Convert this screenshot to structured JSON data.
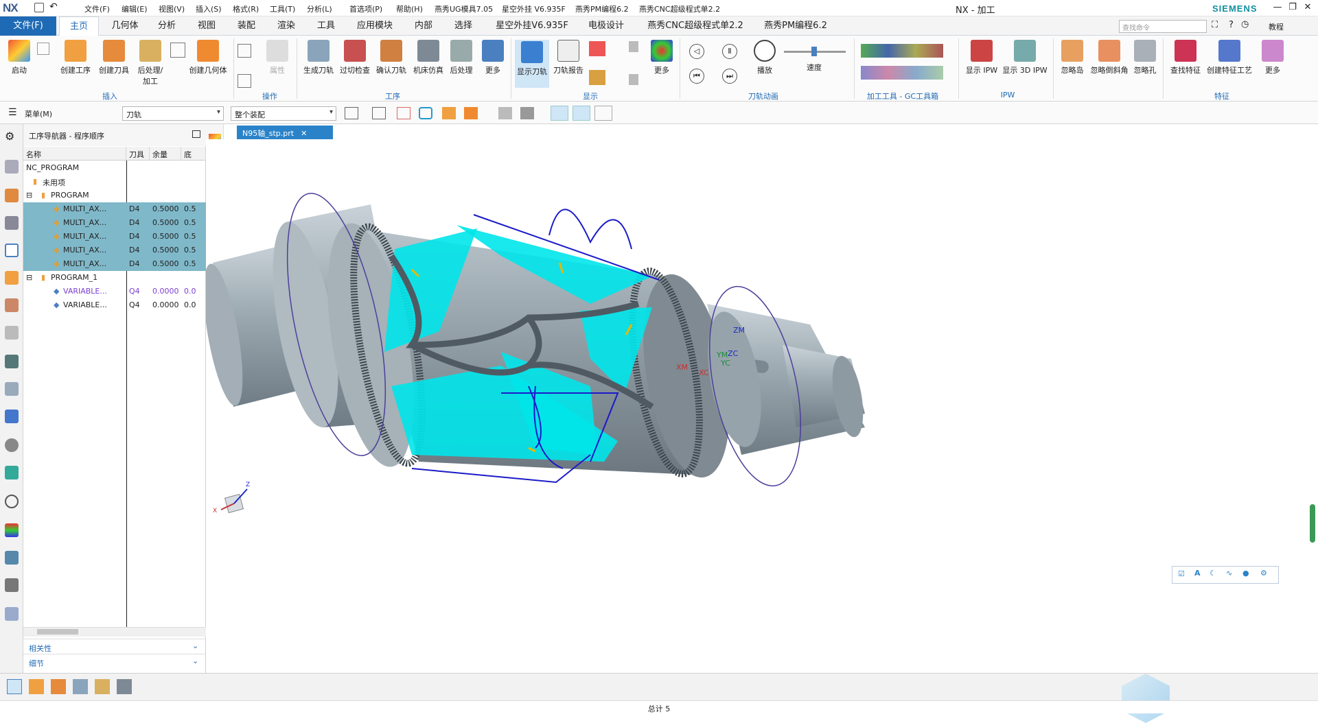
{
  "app": {
    "logo": "NX",
    "title": "NX - 加工",
    "brand": "SIEMENS",
    "window_controls": [
      "—",
      "❐",
      "✕"
    ]
  },
  "quick_access": [
    "文件(F)",
    "编辑(E)",
    "视图(V)",
    "插入(S)",
    "格式(R)",
    "工具(T)",
    "分析(L)",
    "首选项(P)",
    "帮助(H)",
    "燕秀UG模具7.05",
    "星空外挂 V6.935F",
    "燕秀PM编程6.2",
    "燕秀CNC超级程式单2.2"
  ],
  "ribbon_tabs": {
    "file": "文件(F)",
    "tabs": [
      "主页",
      "几何体",
      "分析",
      "视图",
      "装配",
      "渲染",
      "工具",
      "应用模块",
      "内部",
      "选择",
      "星空外挂V6.935F",
      "电极设计",
      "燕秀CNC超级程式单2.2",
      "燕秀PM编程6.2"
    ],
    "active": "主页",
    "search_placeholder": "查找命令",
    "tutorial": "教程"
  },
  "ribbon": {
    "buttons": [
      "启动",
      "创建工序",
      "创建刀具",
      "后处理/加工",
      "创建几何体",
      "属性",
      "生成刀轨",
      "过切检查",
      "确认刀轨",
      "机床仿真",
      "后处理",
      "更多",
      "显示刀轨",
      "刀轨报告",
      "更多",
      "播放",
      "速度",
      "显示 IPW",
      "显示 3D IPW",
      "忽略岛",
      "忽略倒斜角",
      "忽略孔",
      "查找特征",
      "创建特征工艺",
      "更多"
    ],
    "groups": [
      "插入",
      "操作",
      "工序",
      "显示",
      "刀轨动画",
      "加工工具 - GC工具箱",
      "IPW",
      "特征"
    ],
    "colors": {
      "accent": "#1f6ab5",
      "highlight": "#cfe6f7"
    }
  },
  "toolbar": {
    "menu": "菜单(M)",
    "filter1": "刀轨",
    "filter2": "整个装配"
  },
  "navigator": {
    "title": "工序导航器 - 程序顺序",
    "columns": [
      "名称",
      "刀具",
      "余量",
      "底"
    ],
    "rows": [
      {
        "name": "NC_PROGRAM",
        "tool": "",
        "stock": "",
        "floor": "",
        "level": 0,
        "selected": false
      },
      {
        "name": "未用项",
        "tool": "",
        "stock": "",
        "floor": "",
        "level": 1,
        "selected": false
      },
      {
        "name": "PROGRAM",
        "tool": "",
        "stock": "",
        "floor": "",
        "level": 1,
        "selected": false
      },
      {
        "name": "MULTI_AX...",
        "tool": "D4",
        "stock": "0.5000",
        "floor": "0.5",
        "level": 3,
        "selected": true
      },
      {
        "name": "MULTI_AX...",
        "tool": "D4",
        "stock": "0.5000",
        "floor": "0.5",
        "level": 3,
        "selected": true
      },
      {
        "name": "MULTI_AX...",
        "tool": "D4",
        "stock": "0.5000",
        "floor": "0.5",
        "level": 3,
        "selected": true
      },
      {
        "name": "MULTI_AX...",
        "tool": "D4",
        "stock": "0.5000",
        "floor": "0.5",
        "level": 3,
        "selected": true
      },
      {
        "name": "MULTI_AX...",
        "tool": "D4",
        "stock": "0.5000",
        "floor": "0.5",
        "level": 3,
        "selected": true
      },
      {
        "name": "PROGRAM_1",
        "tool": "",
        "stock": "",
        "floor": "",
        "level": 1,
        "selected": false
      },
      {
        "name": "VARIABLE...",
        "tool": "Q4",
        "stock": "0.0000",
        "floor": "0.0",
        "level": 3,
        "selected": false,
        "purple": true
      },
      {
        "name": "VARIABLE...",
        "tool": "Q4",
        "stock": "0.0000",
        "floor": "0.0",
        "level": 3,
        "selected": false
      }
    ],
    "sections": [
      "相关性",
      "细节"
    ]
  },
  "graphics": {
    "tab": "N95轴_stp.prt",
    "csys": {
      "zm": "ZM",
      "xm": "XM",
      "ym": "YM",
      "xc": "XC",
      "zc": "ZC",
      "yc": "YC"
    },
    "triad": {
      "x": "X",
      "z": "Z"
    },
    "colors": {
      "body": "#9aa7af",
      "toolpath": "#00e5ea",
      "path": "#1a1ac8"
    }
  },
  "status": {
    "text": "总计 5"
  }
}
